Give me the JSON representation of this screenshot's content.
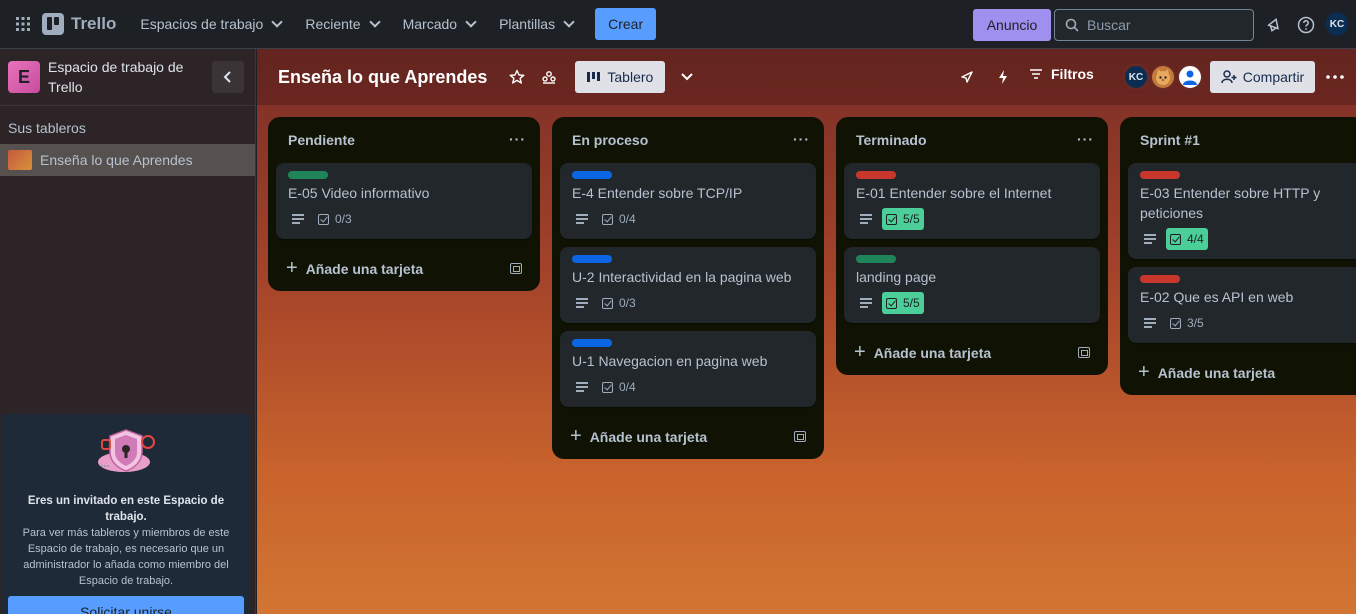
{
  "topbar": {
    "logo_text": "Trello",
    "nav": [
      "Espacios de trabajo",
      "Reciente",
      "Marcado",
      "Plantillas"
    ],
    "create_label": "Crear",
    "announce_label": "Anuncio",
    "search_placeholder": "Buscar",
    "avatar": "KC"
  },
  "sidebar": {
    "workspace_letter": "E",
    "workspace_name": "Espacio de trabajo de Trello",
    "section_title": "Sus tableros",
    "board_name": "Enseña lo que Aprendes",
    "guest_title": "Eres un invitado en este Espacio de trabajo.",
    "guest_text": "Para ver más tableros y miembros de este Espacio de trabajo, es necesario que un administrador lo añada como miembro del Espacio de trabajo.",
    "request_label": "Solicitar unirse"
  },
  "board": {
    "title": "Enseña lo que Aprendes",
    "view_label": "Tablero",
    "filters_label": "Filtros",
    "share_label": "Compartir",
    "member_initials": "KC",
    "add_card_label": "Añade una tarjeta",
    "lists": [
      {
        "title": "Pendiente",
        "cards": [
          {
            "label_color": "#1f845a",
            "title": "E-05 Video informativo",
            "checklist": "0/3",
            "complete": false
          }
        ]
      },
      {
        "title": "En proceso",
        "cards": [
          {
            "label_color": "#0c66e4",
            "title": "E-4 Entender sobre TCP/IP",
            "checklist": "0/4",
            "complete": false
          },
          {
            "label_color": "#0c66e4",
            "title": "U-2 Interactividad en la pagina web",
            "checklist": "0/3",
            "complete": false
          },
          {
            "label_color": "#0c66e4",
            "title": "U-1 Navegacion en pagina web",
            "checklist": "0/4",
            "complete": false
          }
        ]
      },
      {
        "title": "Terminado",
        "cards": [
          {
            "label_color": "#c9372c",
            "title": "E-01 Entender sobre el Internet",
            "checklist": "5/5",
            "complete": true
          },
          {
            "label_color": "#1f845a",
            "title": "landing page",
            "checklist": "5/5",
            "complete": true
          }
        ]
      },
      {
        "title": "Sprint #1",
        "cards": [
          {
            "label_color": "#c9372c",
            "title": "E-03 Entender sobre HTTP y peticiones",
            "checklist": "4/4",
            "complete": true
          },
          {
            "label_color": "#c9372c",
            "title": "E-02 Que es API en web",
            "checklist": "3/5",
            "complete": false
          }
        ]
      }
    ]
  }
}
